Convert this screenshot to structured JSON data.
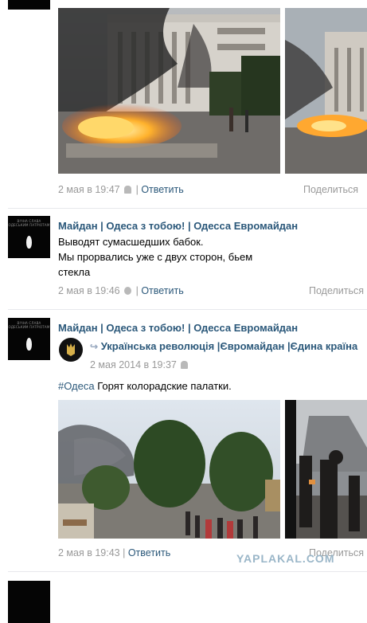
{
  "avatar_caption": "ВІЧНА СЛАВА\nОДЕСЬКИМ ПАТРІОТАМ",
  "posts": [
    {
      "time": "2 мая в 19:47",
      "reply_label": "Ответить",
      "share_label": "Поделиться"
    },
    {
      "author": "Майдан | Одеса з тобою! | Одесса Евромайдан",
      "lines": [
        "Выводят сумасшедших бабок.",
        "Мы прорвались уже с двух сторон, бьем",
        "стекла"
      ],
      "time": "2 мая в 19:46",
      "reply_label": "Ответить",
      "share_label": "Поделиться"
    },
    {
      "author": "Майдан | Одеса з тобою! | Одесса Евромайдан",
      "repost_source": "Українська революція |Євромайдан |Єдина країна",
      "repost_time": "2 мая 2014 в 19:37",
      "hashtag": "#Одеса",
      "text": "Горят колорадские палатки.",
      "time": "2 мая в 19:43",
      "reply_label": "Ответить",
      "share_label": "Поделиться"
    }
  ],
  "watermark": "YAPLAKAL.COM",
  "colors": {
    "link": "#2b587a",
    "meta": "#999999",
    "separator": "#e7e8ec"
  }
}
